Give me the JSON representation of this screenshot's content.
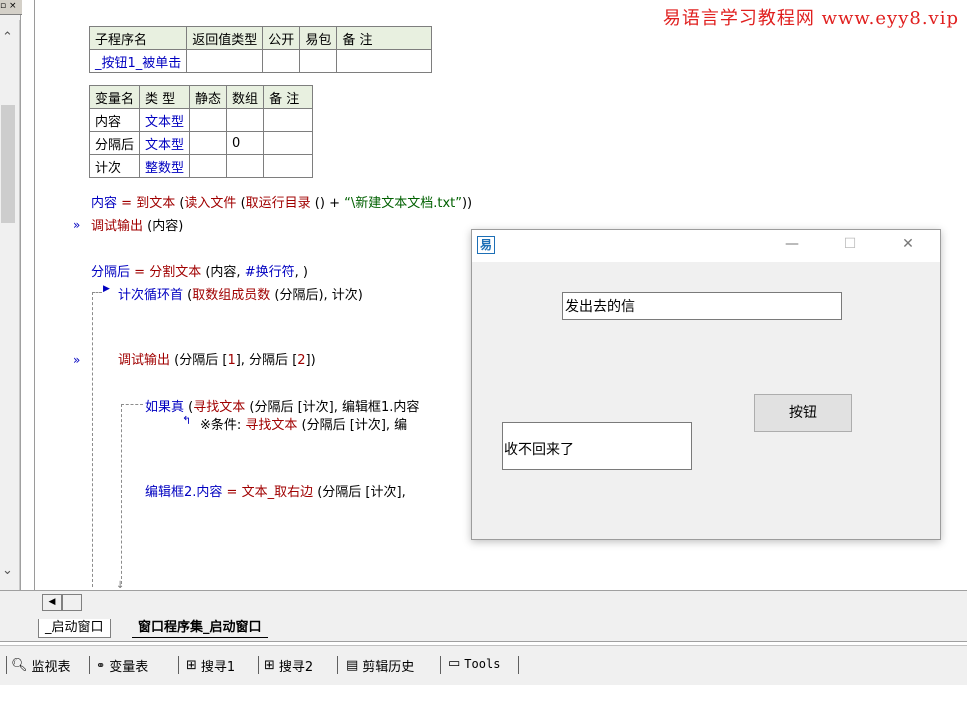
{
  "watermark": "易语言学习教程网 www.eyy8.vip",
  "left_panel": {
    "top_buttons": "▫ ×"
  },
  "sub_table": {
    "headers": [
      "子程序名",
      "返回值类型",
      "公开",
      "易包",
      "备 注"
    ],
    "row": [
      "_按钮1_被单击",
      "",
      "",
      "",
      ""
    ]
  },
  "var_table": {
    "headers": [
      "变量名",
      "类 型",
      "静态",
      "数组",
      "备 注"
    ],
    "rows": [
      [
        "内容",
        "文本型",
        "",
        "",
        ""
      ],
      [
        "分隔后",
        "文本型",
        "",
        "0",
        ""
      ],
      [
        "计次",
        "整数型",
        "",
        "",
        ""
      ]
    ]
  },
  "code": {
    "line1_var": "内容",
    "line1_eq": " = ",
    "line1_fn": "到文本",
    "line1_args_a": " (",
    "line1_fn2": "读入文件",
    "line1_args_b": " (",
    "line1_fn3": "取运行目录",
    "line1_args_c": " () + ",
    "line1_str": "“\\新建文本文档.txt”",
    "line1_end": "))",
    "line2_fn": "调试输出",
    "line2_args": " (内容)",
    "line3_var": "分隔后",
    "line3_eq": " = ",
    "line3_fn": "分割文本",
    "line3_args": " (内容, ",
    "line3_const": "#换行符",
    "line3_end": ", )",
    "line4_fn": "计次循环首",
    "line4_args_a": " (",
    "line4_fn2": "取数组成员数",
    "line4_args_b": " (分隔后), 计次)",
    "line5_fn": "调试输出",
    "line5_args_a": " (分隔后 [",
    "line5_n1": "1",
    "line5_args_b": "], 分隔后 [",
    "line5_n2": "2",
    "line5_args_c": "])",
    "line6_fn": "如果真",
    "line6_args_a": " (",
    "line6_fn2": "寻找文本",
    "line6_args_b": " (分隔后 [计次], 编辑框1.内容",
    "line7_label": "※条件: ",
    "line7_fn": "寻找文本",
    "line7_args": " (分隔后 [计次], 编",
    "line8_var": "编辑框2.内容",
    "line8_eq": " = ",
    "line8_fn": "文本_取右边",
    "line8_args": " (分隔后 [计次],"
  },
  "tabs": [
    {
      "label": "_启动窗口"
    },
    {
      "label": "窗口程序集_启动窗口"
    }
  ],
  "toolbar": {
    "items": [
      {
        "icon": "magnifier-icon",
        "label": "监视表"
      },
      {
        "icon": "glasses-icon",
        "label": "变量表"
      },
      {
        "icon": "search-window-icon",
        "label": "搜寻1"
      },
      {
        "icon": "search-window-icon",
        "label": "搜寻2"
      },
      {
        "icon": "clipboard-icon",
        "label": "剪辑历史"
      },
      {
        "icon": "window-icon",
        "label": "Tools"
      }
    ]
  },
  "dialog": {
    "icon_glyph": "易",
    "minimize": "—",
    "maximize": "☐",
    "close": "✕",
    "edit1_value": "发出去的信",
    "button_label": "按钮",
    "edit2_value": "收不回来了"
  }
}
